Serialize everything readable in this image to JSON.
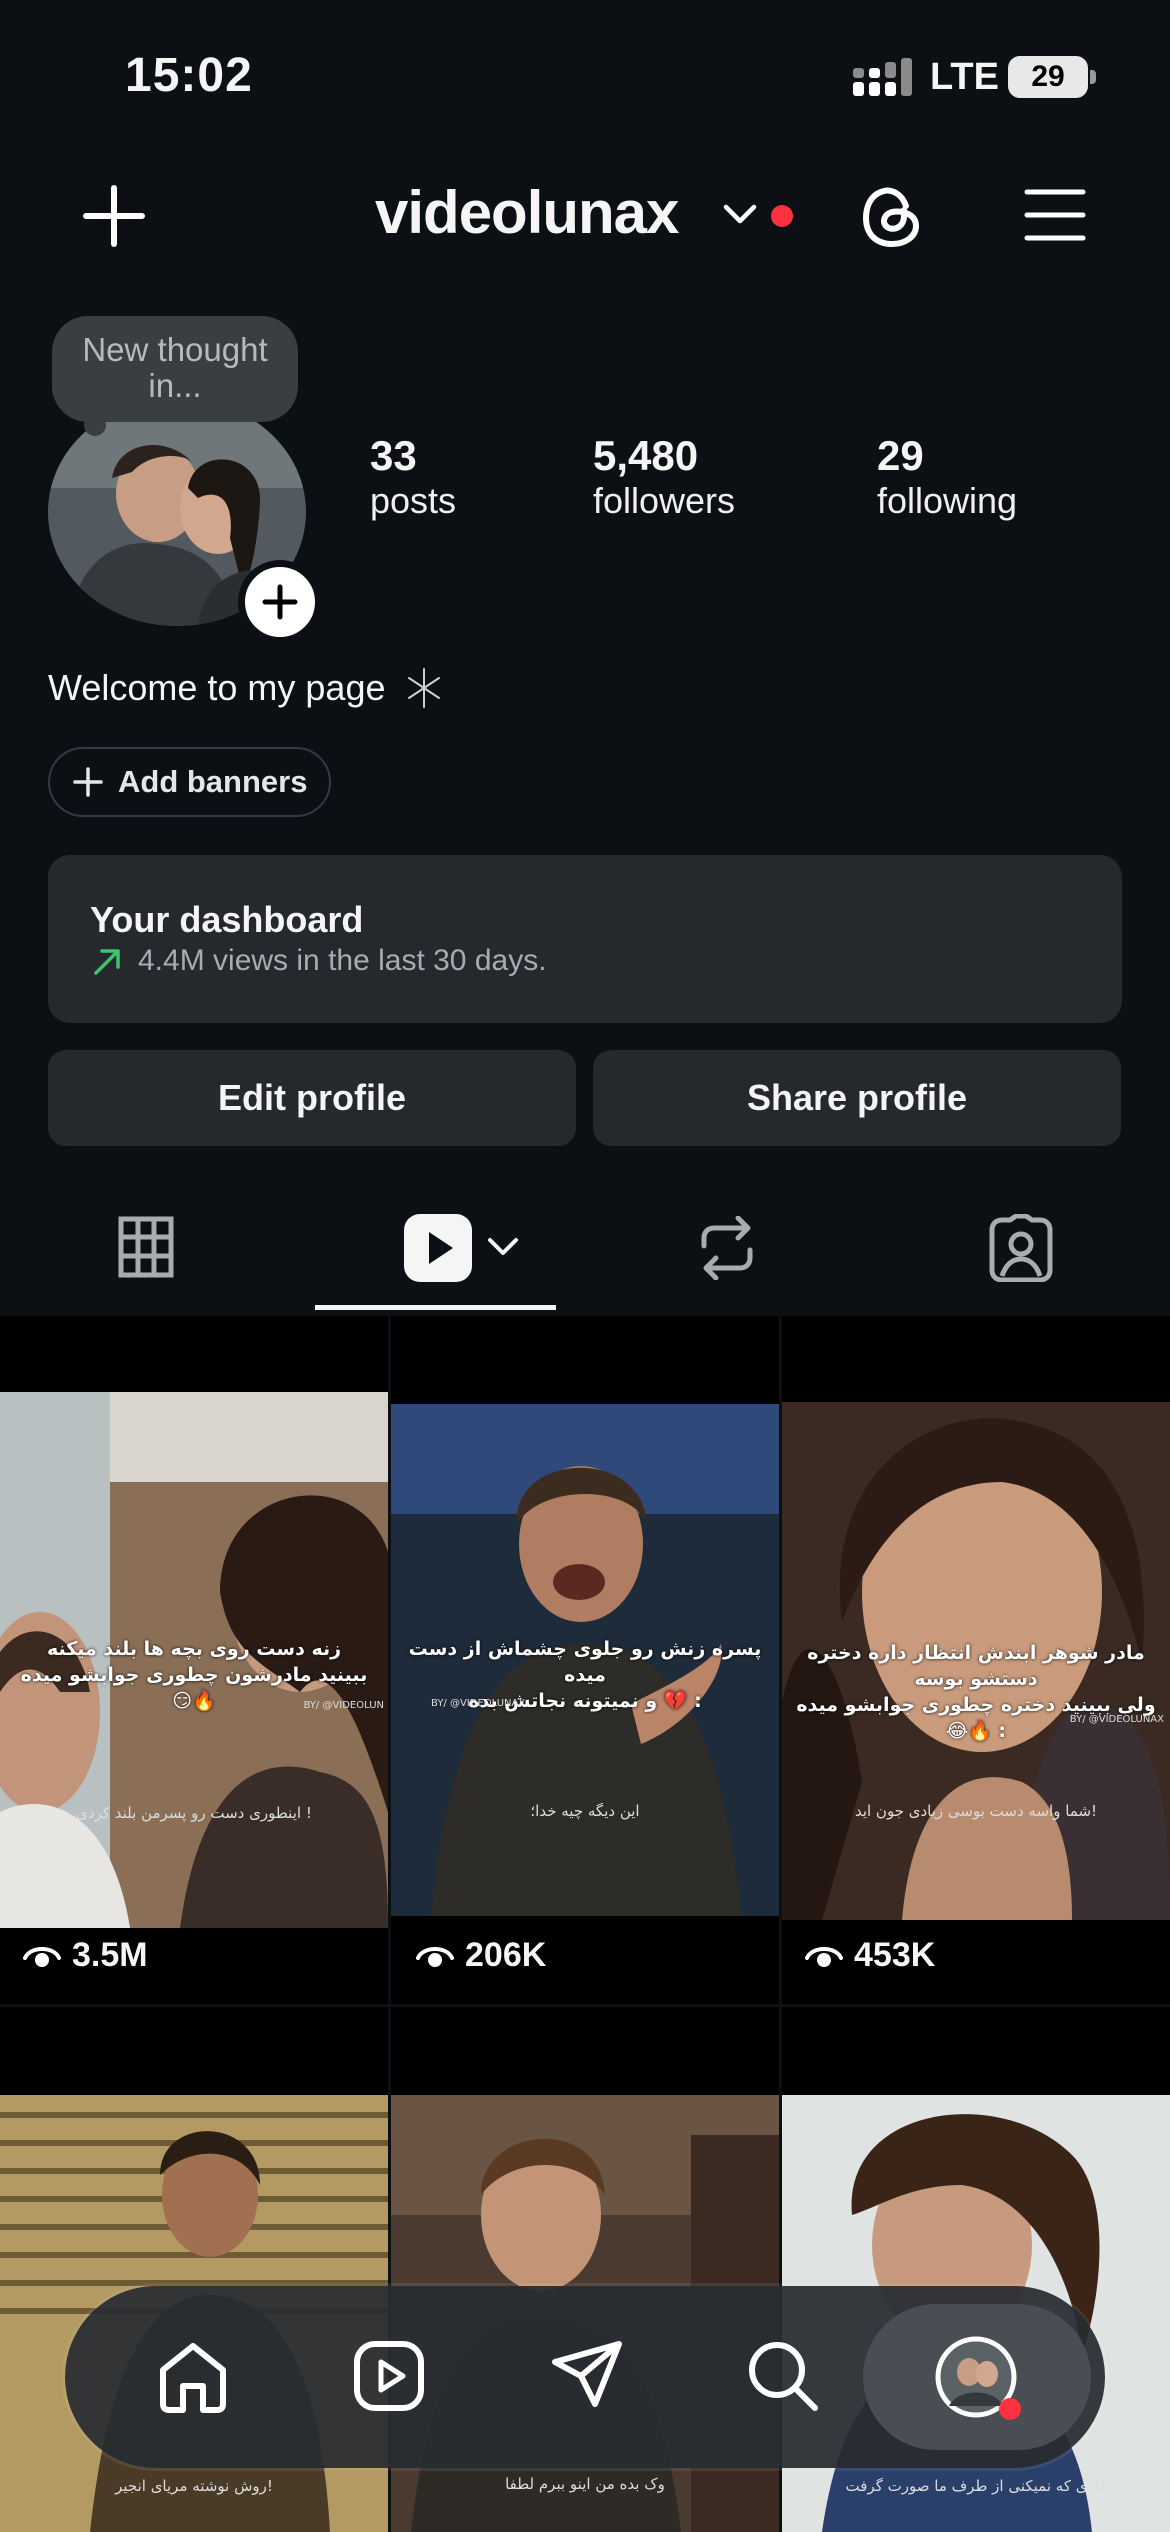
{
  "status_bar": {
    "time": "15:02",
    "network": "LTE",
    "battery": "29"
  },
  "header": {
    "username": "videolunax"
  },
  "profile": {
    "note": "New thought in...",
    "stats": [
      {
        "value": "33",
        "label": "posts"
      },
      {
        "value": "5,480",
        "label": "followers"
      },
      {
        "value": "29",
        "label": "following"
      }
    ],
    "bio": "Welcome to my page",
    "add_banners_label": "Add banners"
  },
  "dashboard": {
    "title": "Your dashboard",
    "subtitle": "4.4M views in the last 30 days."
  },
  "actions": {
    "edit_label": "Edit profile",
    "share_label": "Share profile"
  },
  "grid": [
    {
      "views": "3.5M",
      "caption_line1": "زنه دست روی بچه ها بلند میکنه",
      "caption_line2": "ببینید مادرشون چطوری جوابشو میده 😏🔥",
      "subtitle": "اینطوری دست رو پسرمن بلند کردی !",
      "signature": "BY/ @VIDEOLUN"
    },
    {
      "views": "206K",
      "caption_line1": "پسره زنش رو جلوی چشماش از دست میده",
      "caption_line2": "و نمیتونه نجاتش بده 💔 :",
      "subtitle": "این دیگه چیه خدا؛",
      "signature": "BY/ @VIDEOLUNAX"
    },
    {
      "views": "453K",
      "caption_line1": "مادر شوهر ابندش انتظار داره دختره دستشو بوسه",
      "caption_line2": "ولی ببینید دختره چطوری جوابشو میده 😂🔥 :",
      "subtitle": "شما واسه دست بوسی زیادی جون اید!",
      "signature": "BY/ @VIDEOLUNAX"
    },
    {
      "subtitle": "روش نوشته مریای انجیر!"
    },
    {
      "subtitle": "وک بده من اینو ببرم لطفا"
    },
    {
      "subtitle": "کاری که نمیکنی از طرف ما صورت گرفت"
    }
  ],
  "colors": {
    "background": "#0c1014",
    "card": "#25292e",
    "accent_red": "#ff3040",
    "trend_green": "#3ec46d"
  }
}
